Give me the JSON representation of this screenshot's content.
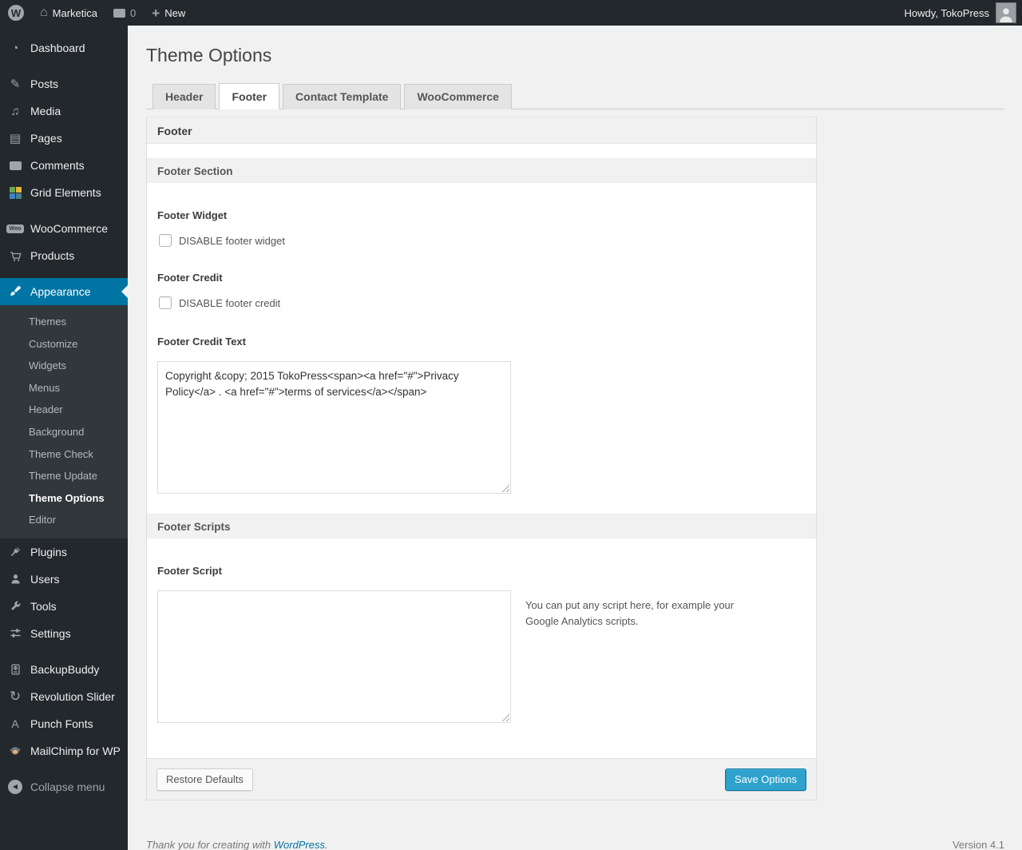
{
  "colors": {
    "accent": "#0074a2",
    "primary_button": "#2ea2cc",
    "menu_background": "#23282d",
    "submenu_background": "#32373c",
    "page_background": "#f1f1f1"
  },
  "admin_bar": {
    "site_name": "Marketica",
    "comments_count": "0",
    "new_label": "New",
    "howdy": "Howdy, TokoPress"
  },
  "sidebar": {
    "items": [
      {
        "label": "Dashboard"
      },
      {
        "label": "Posts"
      },
      {
        "label": "Media"
      },
      {
        "label": "Pages"
      },
      {
        "label": "Comments"
      },
      {
        "label": "Grid Elements"
      },
      {
        "label": "WooCommerce"
      },
      {
        "label": "Products"
      },
      {
        "label": "Appearance"
      },
      {
        "label": "Plugins"
      },
      {
        "label": "Users"
      },
      {
        "label": "Tools"
      },
      {
        "label": "Settings"
      },
      {
        "label": "BackupBuddy"
      },
      {
        "label": "Revolution Slider"
      },
      {
        "label": "Punch Fonts"
      },
      {
        "label": "MailChimp for WP"
      }
    ],
    "appearance_submenu": [
      "Themes",
      "Customize",
      "Widgets",
      "Menus",
      "Header",
      "Background",
      "Theme Check",
      "Theme Update",
      "Theme Options",
      "Editor"
    ],
    "active_submenu": "Theme Options",
    "woo_badge": "Woo",
    "punch_fonts_glyph": "A",
    "collapse_label": "Collapse menu"
  },
  "page": {
    "title": "Theme Options",
    "tabs": [
      {
        "label": "Header",
        "active": false
      },
      {
        "label": "Footer",
        "active": true
      },
      {
        "label": "Contact Template",
        "active": false
      },
      {
        "label": "WooCommerce",
        "active": false
      }
    ]
  },
  "panel": {
    "group_title": "Footer",
    "section1_title": "Footer Section",
    "footer_widget": {
      "label": "Footer Widget",
      "checkbox_label": "DISABLE footer widget",
      "checked": false
    },
    "footer_credit": {
      "label": "Footer Credit",
      "checkbox_label": "DISABLE footer credit",
      "checked": false
    },
    "footer_credit_text": {
      "label": "Footer Credit Text",
      "value": "Copyright &copy; 2015 TokoPress<span><a href=\"#\">Privacy Policy</a> . <a href=\"#\">terms of services</a></span>"
    },
    "section2_title": "Footer Scripts",
    "footer_script": {
      "label": "Footer Script",
      "value": "",
      "help": "You can put any script here, for example your Google Analytics scripts."
    },
    "actions": {
      "restore": "Restore Defaults",
      "save": "Save Options"
    }
  },
  "wp_footer": {
    "thanks_prefix": "Thank you for creating with ",
    "link_label": "WordPress",
    "suffix": ".",
    "version": "Version 4.1"
  }
}
